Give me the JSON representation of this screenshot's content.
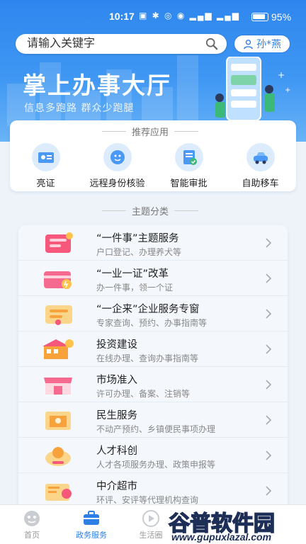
{
  "status_bar": {
    "time": "10:17",
    "battery": "95%"
  },
  "search": {
    "placeholder": "请输入关键字"
  },
  "user": {
    "name": "孙*燕"
  },
  "hero": {
    "title": "掌上办事大厅",
    "subtitle": "信息多跑路  群众少跑腿"
  },
  "recommended": {
    "title": "推荐应用",
    "apps": [
      {
        "label": "亮证",
        "icon": "id-card-icon"
      },
      {
        "label": "远程身份核验",
        "icon": "face-verify-icon"
      },
      {
        "label": "智能审批",
        "icon": "approval-icon"
      },
      {
        "label": "自助移车",
        "icon": "car-move-icon"
      }
    ]
  },
  "categories": {
    "title": "主题分类",
    "items": [
      {
        "title": "“一件事”主题服务",
        "subtitle": "户口登记、办理养犬等",
        "color": "#f5587a"
      },
      {
        "title": "“一业一证”改革",
        "subtitle": "办一件事，领一个证",
        "color": "#f56a8e"
      },
      {
        "title": "“一企来”企业服务专窗",
        "subtitle": "专家查询、预约、办事指南等",
        "color": "#f7a23b"
      },
      {
        "title": "投资建设",
        "subtitle": "在线办理、查询办事指南等",
        "color": "#f7a23b"
      },
      {
        "title": "市场准入",
        "subtitle": "许可办理、备案、注销等",
        "color": "#f56a8e"
      },
      {
        "title": "民生服务",
        "subtitle": "不动产预约、乡镇便民事项办理",
        "color": "#f7a23b"
      },
      {
        "title": "人才科创",
        "subtitle": "人才各项服务办理、政策申报等",
        "color": "#f7a23b"
      },
      {
        "title": "中介超市",
        "subtitle": "环评、安评等代理机构查询",
        "color": "#f7a23b"
      }
    ]
  },
  "tabs": [
    {
      "label": "首页",
      "active": false
    },
    {
      "label": "政务服务",
      "active": true
    },
    {
      "label": "生活圈",
      "active": false
    }
  ],
  "watermark": {
    "logo": "谷普软件园",
    "url": "www.gupuxlazal.com"
  },
  "colors": {
    "primary": "#2d7fe6",
    "hero": "#3f97f3"
  }
}
